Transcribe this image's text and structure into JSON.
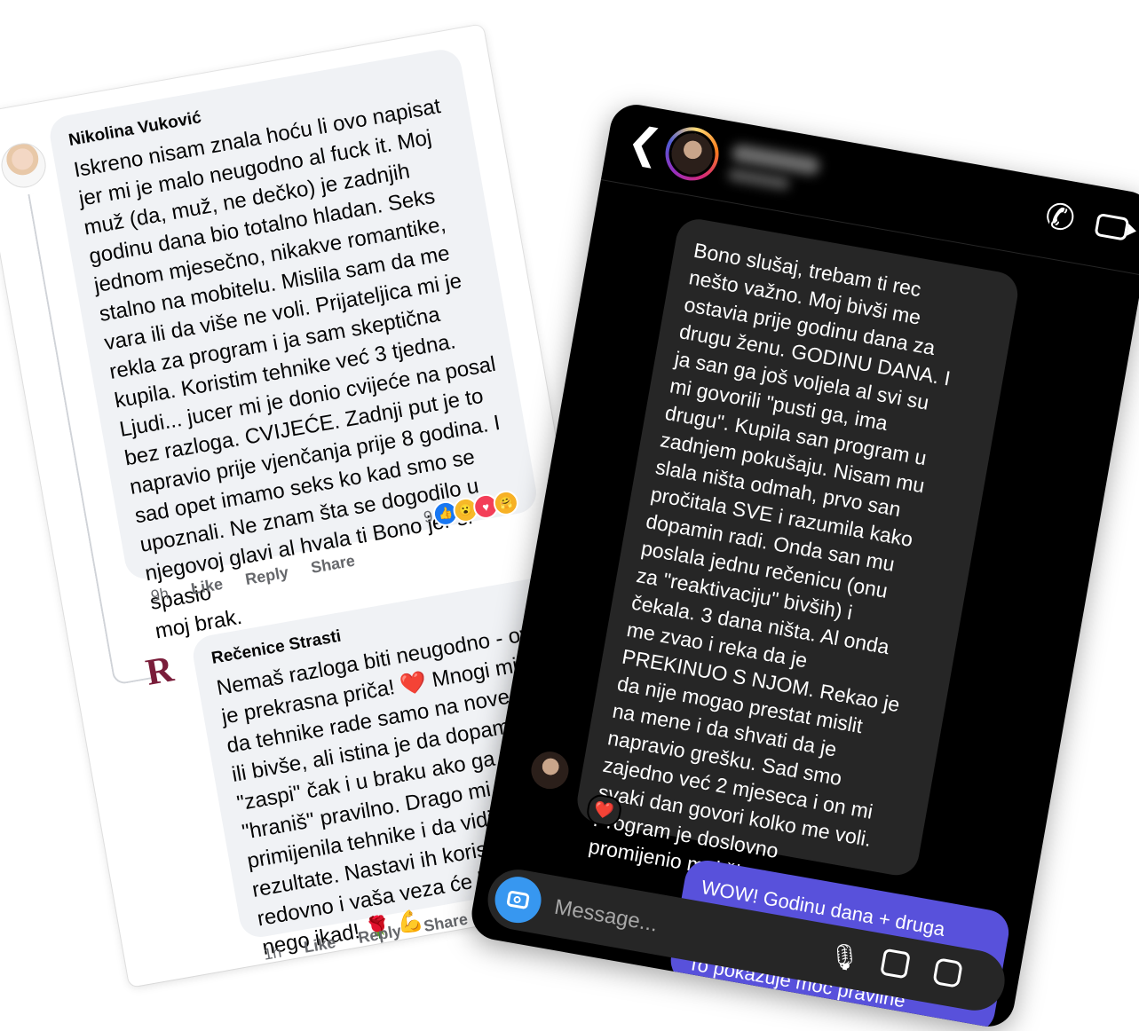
{
  "fb": {
    "comment1": {
      "name": "Nikolina Vuković",
      "text": "Iskreno nisam znala hoću li ovo napisat\njer mi je malo neugodno al fuck it. Moj\nmuž (da, muž, ne dečko) je zadnjih\ngodinu dana bio totalno hladan. Seks\njednom mjesečno, nikakve romantike,\nstalno na mobitelu. Mislila sam da me\nvara ili da više ne voli. Prijateljica mi je\nrekla za program i ja sam skeptična\nkupila. Koristim tehnike već 3 tjedna.\nLjudi... jucer mi je donio cvijeće na posal\nbez razloga. CVIJEĆE. Zadnji put je to\nnapravio prije vjenčanja prije 8 godina. I\nsad opet imamo seks ko kad smo se\nupoznali. Ne znam šta se dogodilo u\nnjegovoj glavi al hvala ti Bono jer si spasio\nmoj brak.",
      "reaction_count": "9",
      "time": "9h",
      "like": "Like",
      "reply": "Reply",
      "share": "Share"
    },
    "comment2": {
      "logo_letter": "R",
      "name": "Rečenice Strasti",
      "text": "Nemaš razloga biti neugodno - ov\nje prekrasna priča! ❤️ Mnogi misl\nda tehnike rade samo na nove ve\nili bivše, ali istina je da dopamin\n\"zaspi\" čak i u braku ako ga ne\n\"hraniš\" pravilno. Drago mi je\nprimijenila tehnike i da vidiš\nrezultate. Nastavi ih koristit\nredovno i vaša veza će bit\nnego ikad! 🌹 💪",
      "time": "1h",
      "like": "Like",
      "reply": "Reply",
      "share": "Share"
    }
  },
  "ig": {
    "incoming_message": "Bono slušaj, trebam ti rec\nnešto važno. Moj bivši me\nostavia prije godinu dana za\ndrugu ženu. GODINU DANA. I\nja san ga još voljela al svi su\nmi govorili \"pusti ga, ima\ndrugu\". Kupila san program u\nzadnjem pokušaju. Nisam mu\nslala ništa odmah, prvo san\npročitala SVE i razumila kako\ndopamin radi. Onda san mu\nposlala jednu rečenicu (onu\nza \"reaktivaciju\" bivših) i\nčekala. 3 dana ništa. Al onda\nme zvao i reka da je\nPREKINUO S NJOM. Rekao je\nda nije mogao prestat mislit\nna mene i da shvati da je\nnapravio grešku. Sad smo\nzajedno već 2 mjeseca i on mi\nsvaki dan govori kolko me voli.\nProgram je doslovno\npromijenio moj život.",
    "reaction": "❤️",
    "outgoing_message": "WOW! Godinu dana + druga žena\n= najteža situacija, i ti si uspjela!\nTo pokazuje moć pravilne",
    "composer_placeholder": "Message...",
    "back_glyph": "❮",
    "call_glyph": "✆",
    "mic_glyph": "🎙"
  }
}
